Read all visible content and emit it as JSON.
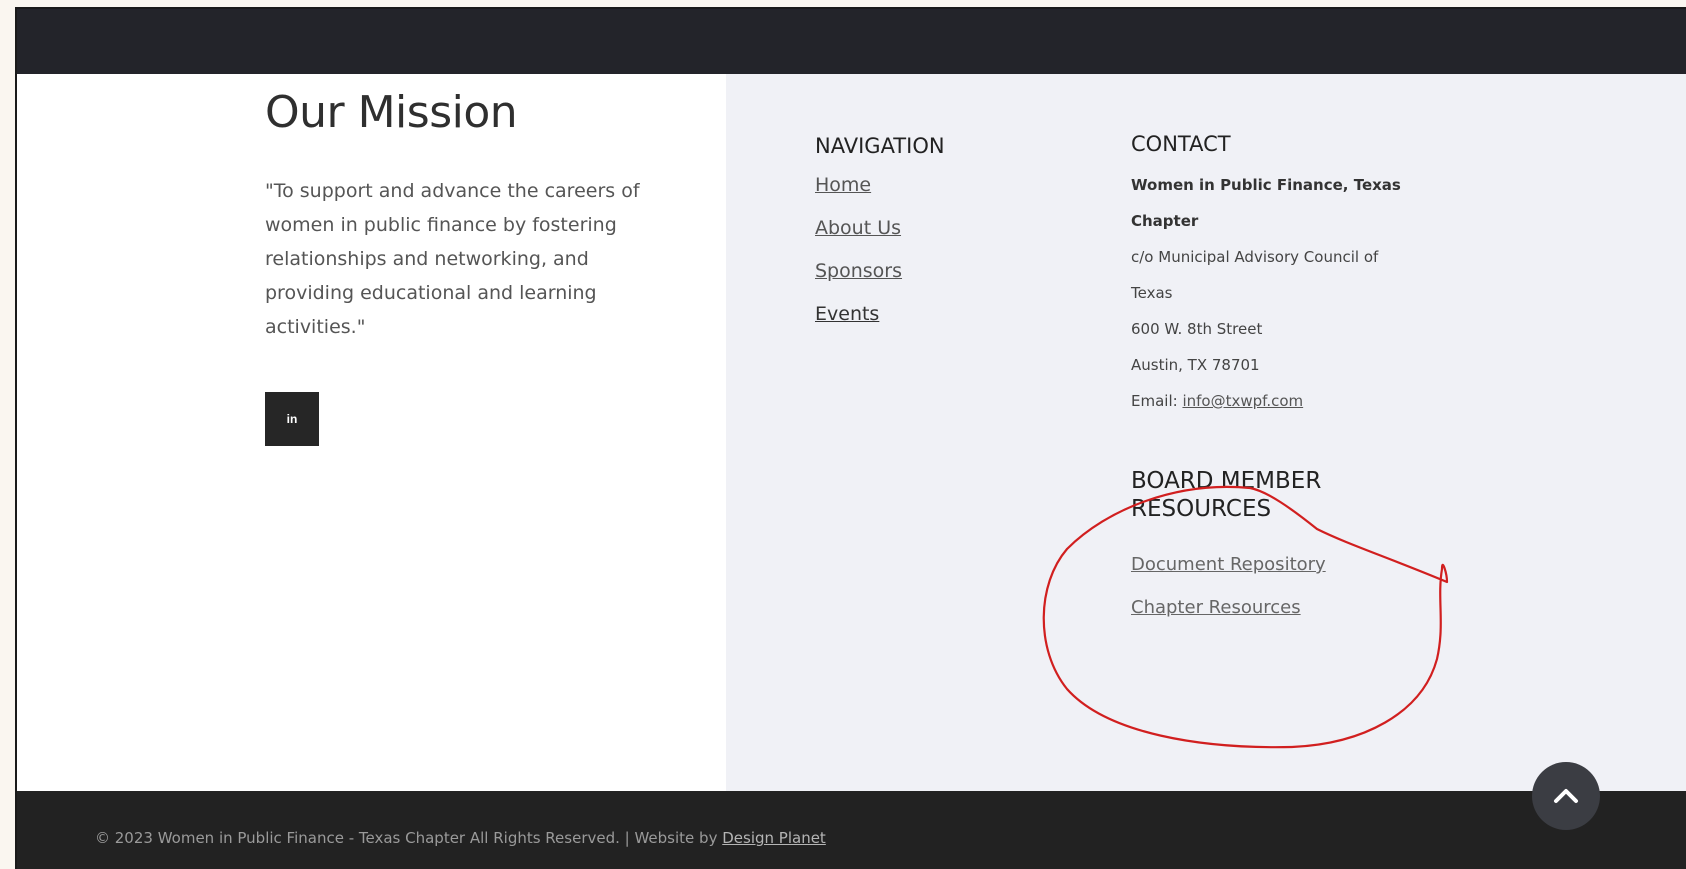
{
  "mission": {
    "title": "Our Mission",
    "text": "\"To support and advance the careers of women in public finance by fostering relationships and networking, and providing educational and learning activities.\"",
    "social_icon": "linkedin-icon",
    "social_label": "in"
  },
  "navigation": {
    "heading": "NAVIGATION",
    "items": [
      {
        "label": "Home"
      },
      {
        "label": "About Us"
      },
      {
        "label": "Sponsors"
      },
      {
        "label": "Events"
      }
    ]
  },
  "contact": {
    "heading": "CONTACT",
    "org_line1": "Women in Public Finance, Texas",
    "org_line2": "Chapter",
    "co_line1": "c/o Municipal Advisory Council of",
    "co_line2": "Texas",
    "street": "600 W. 8th Street",
    "city": "Austin, TX 78701",
    "email_label": "Email:",
    "email": "info@txwpf.com"
  },
  "board": {
    "heading_line1": "BOARD MEMBER",
    "heading_line2": "RESOURCES",
    "items": [
      {
        "label": "Document Repository"
      },
      {
        "label": "Chapter Resources"
      }
    ]
  },
  "footer": {
    "copyright": "© 2023 Women in Public Finance - Texas Chapter  All Rights Reserved.  |  Website by",
    "credit_link": "Design Planet"
  },
  "scroll_top_icon": "chevron-up-icon",
  "colors": {
    "topbar": "#23242a",
    "footer": "#222222",
    "right_panel": "#f0f1f6",
    "annotation": "#d11f1f"
  }
}
